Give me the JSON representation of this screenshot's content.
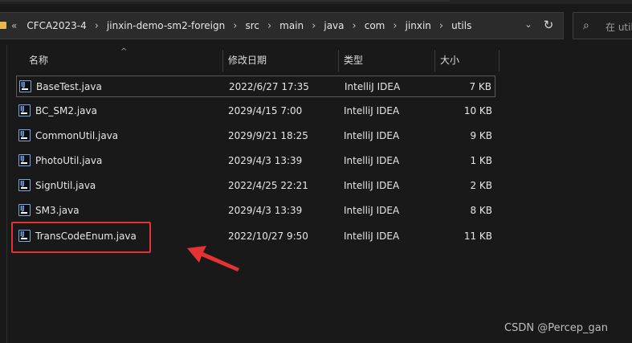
{
  "address": {
    "prefix": "«",
    "crumbs": [
      "CFCA2023-4",
      "jinxin-demo-sm2-foreign",
      "src",
      "main",
      "java",
      "com",
      "jinxin",
      "utils"
    ],
    "dropdown_icon": "chevron-down-icon",
    "refresh_icon": "refresh-icon"
  },
  "search": {
    "placeholder": "在 util"
  },
  "columns": {
    "name": "名称",
    "date": "修改日期",
    "type": "类型",
    "size": "大小"
  },
  "files": [
    {
      "name": "BaseTest.java",
      "date": "2022/6/27 17:35",
      "type": "IntelliJ IDEA",
      "size": "7 KB"
    },
    {
      "name": "BC_SM2.java",
      "date": "2029/4/15 7:00",
      "type": "IntelliJ IDEA",
      "size": "10 KB"
    },
    {
      "name": "CommonUtil.java",
      "date": "2029/9/21 18:25",
      "type": "IntelliJ IDEA",
      "size": "9 KB"
    },
    {
      "name": "PhotoUtil.java",
      "date": "2029/4/3 13:39",
      "type": "IntelliJ IDEA",
      "size": "1 KB"
    },
    {
      "name": "SignUtil.java",
      "date": "2022/4/25 22:21",
      "type": "IntelliJ IDEA",
      "size": "2 KB"
    },
    {
      "name": "SM3.java",
      "date": "2029/4/3 13:39",
      "type": "IntelliJ IDEA",
      "size": "8 KB"
    },
    {
      "name": "TransCodeEnum.java",
      "date": "2022/10/27 9:50",
      "type": "IntelliJ IDEA",
      "size": "11 KB"
    }
  ],
  "file_icon": "intellij-java-file-icon",
  "colors": {
    "highlight": "#e53232",
    "background": "#191919"
  },
  "watermark": "CSDN @Percep_gan"
}
